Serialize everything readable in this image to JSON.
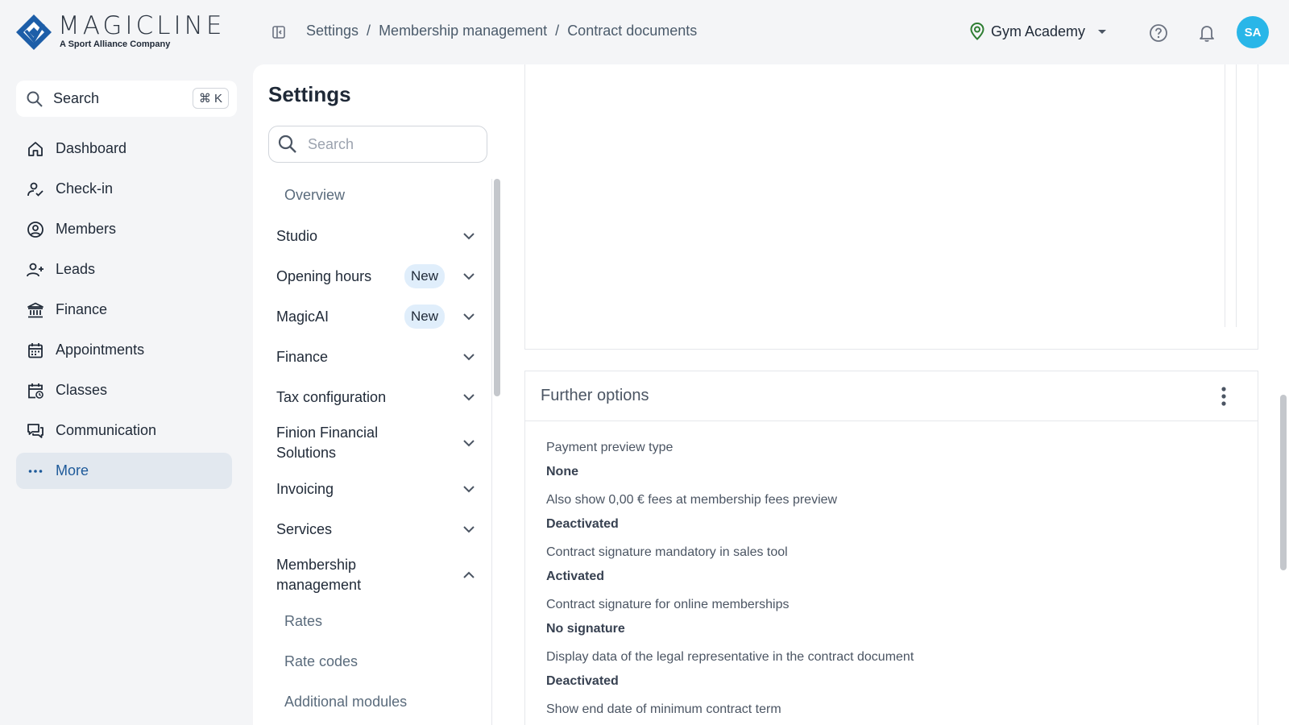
{
  "brand": {
    "name": "MAGICLINE",
    "tagline": "A Sport Alliance Company"
  },
  "breadcrumb": [
    "Settings",
    "Membership management",
    "Contract documents"
  ],
  "header": {
    "studio": "Gym Academy",
    "avatar_initials": "SA"
  },
  "sidebar": {
    "search_label": "Search",
    "search_shortcut": "⌘ K",
    "items": [
      {
        "label": "Dashboard",
        "icon": "home-icon"
      },
      {
        "label": "Check-in",
        "icon": "user-check-icon"
      },
      {
        "label": "Members",
        "icon": "user-circle-icon"
      },
      {
        "label": "Leads",
        "icon": "user-plus-icon"
      },
      {
        "label": "Finance",
        "icon": "bank-icon"
      },
      {
        "label": "Appointments",
        "icon": "calendar-icon"
      },
      {
        "label": "Classes",
        "icon": "calendar-clock-icon"
      },
      {
        "label": "Communication",
        "icon": "chat-icon"
      },
      {
        "label": "More",
        "icon": "more-icon",
        "active": true
      }
    ]
  },
  "settings": {
    "title": "Settings",
    "search_placeholder": "Search",
    "items": [
      {
        "label": "Overview"
      },
      {
        "label": "Studio"
      },
      {
        "label": "Opening hours",
        "badge": "New"
      },
      {
        "label": "MagicAI",
        "badge": "New"
      },
      {
        "label": "Finance"
      },
      {
        "label": "Tax configuration"
      },
      {
        "label": "Finion Financial",
        "label2": "Solutions"
      },
      {
        "label": "Invoicing"
      },
      {
        "label": "Services"
      },
      {
        "label": "Membership",
        "label2": "management"
      },
      {
        "label": "Rates"
      },
      {
        "label": "Rate codes"
      },
      {
        "label": "Additional modules"
      }
    ]
  },
  "further_options": {
    "title": "Further options",
    "rows": [
      {
        "label": "Payment preview type",
        "value": "None"
      },
      {
        "label": "Also show 0,00 € fees at membership fees preview",
        "value": "Deactivated"
      },
      {
        "label": "Contract signature mandatory in sales tool",
        "value": "Activated"
      },
      {
        "label": "Contract signature for online memberships",
        "value": "No signature"
      },
      {
        "label": "Display data of the legal representative in the contract document",
        "value": "Deactivated"
      },
      {
        "label": "Show end date of minimum contract term",
        "value": ""
      }
    ]
  }
}
